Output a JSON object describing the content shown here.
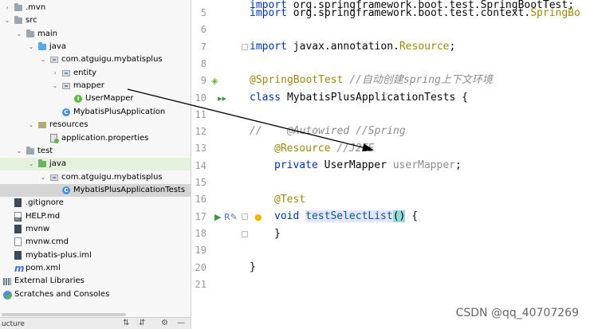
{
  "project_tree": [
    {
      "label": ".mvn",
      "depth": 0,
      "arrow": "›",
      "icon": "folder-icon"
    },
    {
      "label": "src",
      "depth": 0,
      "arrow": "⌄",
      "icon": "folder-icon"
    },
    {
      "label": "main",
      "depth": 1,
      "arrow": "⌄",
      "icon": "folder-icon"
    },
    {
      "label": "java",
      "depth": 2,
      "arrow": "⌄",
      "icon": "source-folder-icon"
    },
    {
      "label": "com.atguigu.mybatisplus",
      "depth": 3,
      "arrow": "⌄",
      "icon": "package-icon"
    },
    {
      "label": "entity",
      "depth": 4,
      "arrow": "›",
      "icon": "package-icon"
    },
    {
      "label": "mapper",
      "depth": 4,
      "arrow": "⌄",
      "icon": "package-icon"
    },
    {
      "label": "UserMapper",
      "depth": 5,
      "arrow": "",
      "icon": "interface-icon"
    },
    {
      "label": "MybatisPlusApplication",
      "depth": 4,
      "arrow": "",
      "icon": "class-icon"
    },
    {
      "label": "resources",
      "depth": 2,
      "arrow": "⌄",
      "icon": "resources-folder-icon"
    },
    {
      "label": "application.properties",
      "depth": 3,
      "arrow": "",
      "icon": "properties-file-icon"
    },
    {
      "label": "test",
      "depth": 1,
      "arrow": "⌄",
      "icon": "folder-icon"
    },
    {
      "label": "java",
      "depth": 2,
      "arrow": "⌄",
      "icon": "test-folder-icon"
    },
    {
      "label": "com.atguigu.mybatisplus",
      "depth": 3,
      "arrow": "⌄",
      "icon": "package-icon"
    },
    {
      "label": "MybatisPlusApplicationTests",
      "depth": 4,
      "arrow": "",
      "icon": "class-icon"
    },
    {
      "label": ".gitignore",
      "depth": 0,
      "arrow": "",
      "icon": "gitignore-file-icon"
    },
    {
      "label": "HELP.md",
      "depth": 0,
      "arrow": "",
      "icon": "markdown-file-icon"
    },
    {
      "label": "mvnw",
      "depth": 0,
      "arrow": "",
      "icon": "file-icon"
    },
    {
      "label": "mvnw.cmd",
      "depth": 0,
      "arrow": "",
      "icon": "cmd-file-icon"
    },
    {
      "label": "mybatis-plus.iml",
      "depth": 0,
      "arrow": "",
      "icon": "iml-file-icon"
    },
    {
      "label": "pom.xml",
      "depth": 0,
      "arrow": "",
      "icon": "maven-pom-icon"
    },
    {
      "label": "External Libraries",
      "depth": -1,
      "arrow": "›",
      "icon": "libraries-icon"
    },
    {
      "label": "Scratches and Consoles",
      "depth": -1,
      "arrow": "",
      "icon": "scratches-icon"
    }
  ],
  "bottom_bar": {
    "structure_label": "ucture"
  },
  "code_lines": [
    {
      "num": "5",
      "text": "import org.springframework.boot.test.context.SpringBo"
    },
    {
      "num": "6",
      "text": ""
    },
    {
      "num": "7",
      "text": "import javax.annotation.Resource;"
    },
    {
      "num": "8",
      "text": ""
    },
    {
      "num": "9",
      "text": "@SpringBootTest //自动创建spring上下文环境"
    },
    {
      "num": "10",
      "text": "class MybatisPlusApplicationTests {"
    },
    {
      "num": "11",
      "text": ""
    },
    {
      "num": "12",
      "text": "//    @Autowired //Spring"
    },
    {
      "num": "13",
      "text": "    @Resource //J2EE"
    },
    {
      "num": "14",
      "text": "    private UserMapper userMapper;"
    },
    {
      "num": "15",
      "text": ""
    },
    {
      "num": "16",
      "text": "    @Test"
    },
    {
      "num": "17",
      "text": "    void testSelectList() {"
    },
    {
      "num": "18",
      "text": "    }"
    },
    {
      "num": "19",
      "text": ""
    },
    {
      "num": "20",
      "text": "}"
    },
    {
      "num": "21",
      "text": ""
    }
  ],
  "code_tokens": {
    "l5_import": "import",
    "l5_rest": " org.springframework.boot.test.context.",
    "l5_cls": "SpringBo",
    "l7_import": "import",
    "l7_rest": " javax.annotation.",
    "l7_cls": "Resource",
    "l7_semi": ";",
    "l9_ann": "@SpringBootTest",
    "l9_cmt": " //自动创建spring上下文环境",
    "l10_kw": "class",
    "l10_rest": " MybatisPlusApplicationTests {",
    "l12_cmt": "//    @Autowired //Spring",
    "l13_ann": "@Resource",
    "l13_cmt": " //J2EE",
    "l14_kw": "private",
    "l14_type": " UserMapper ",
    "l14_field": "userMapper",
    "l14_semi": ";",
    "l16_ann": "@Test",
    "l17_kw": "void",
    "l17_method": "testSelectList",
    "l17_paren": "()",
    "l17_brace": " {",
    "l18": "}",
    "l20": "}"
  },
  "watermark": "CSDN @qq_40707269",
  "colors": {
    "keyword": "#0033b3",
    "annotation": "#9e880d",
    "comment": "#8c8c8c",
    "field": "#871094",
    "method": "#00627a",
    "selection": "#d5d5d5",
    "test_folder_bg": "#e5f1dd"
  }
}
